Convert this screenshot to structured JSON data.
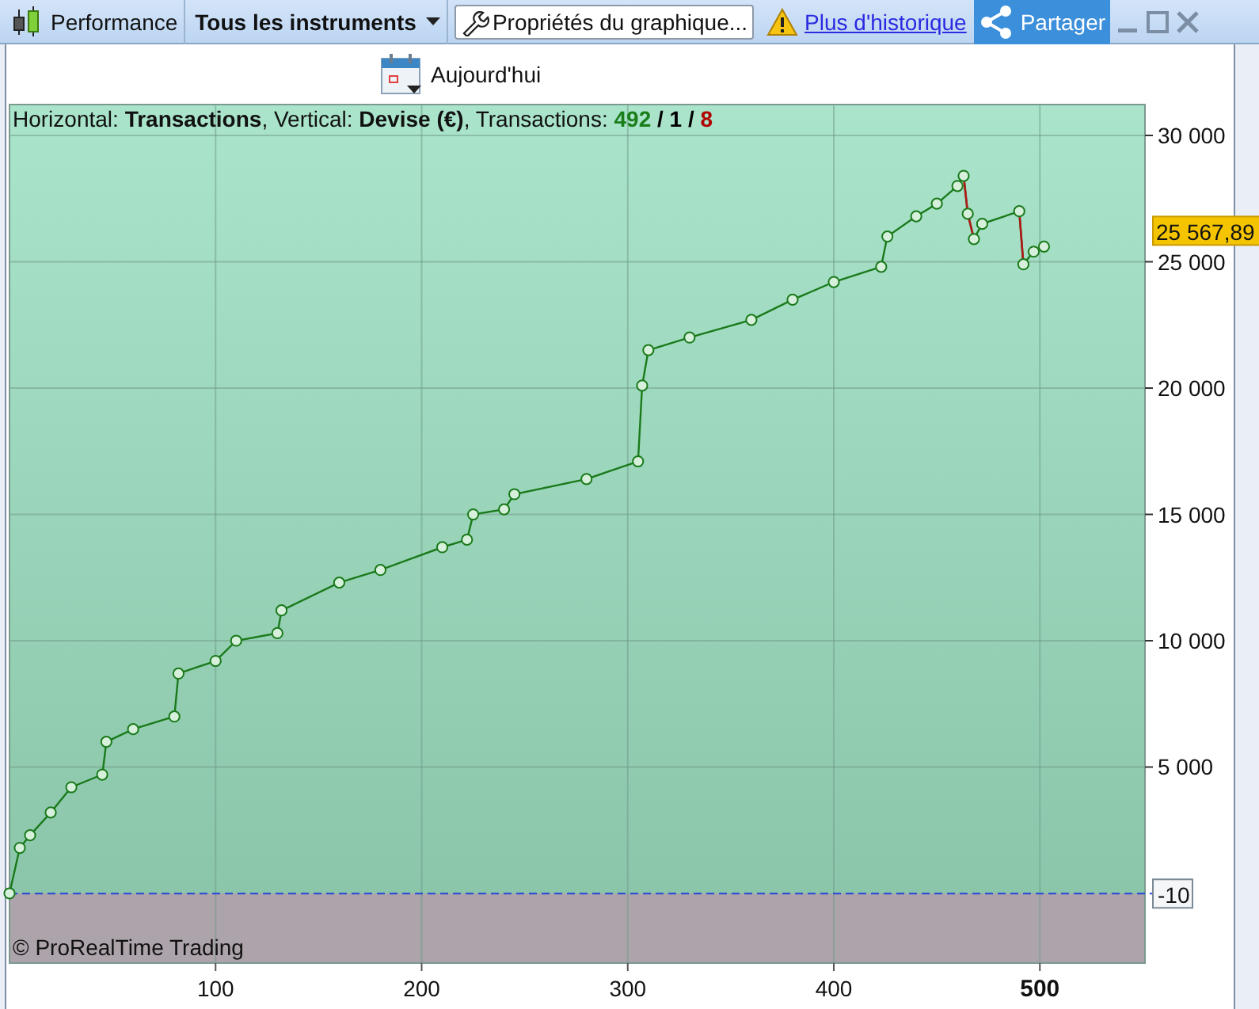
{
  "toolbar": {
    "performance_tab": "Performance",
    "instruments_menu": "Tous les instruments",
    "properties_button": "Propriétés du graphique...",
    "history_link": "Plus d'historique",
    "share_button": "Partager"
  },
  "date_selector": {
    "label": "Aujourd'hui"
  },
  "chart": {
    "info": "Horizontal: **Transactions**, Vertical: **Devise (€)**, Transactions:",
    "info_counts": [
      {
        "text": "492",
        "color": "#1a7f1a"
      },
      {
        "text": "/",
        "color": "#000000"
      },
      {
        "text": "1",
        "color": "#000000"
      },
      {
        "text": "/",
        "color": "#000000"
      },
      {
        "text": "8",
        "color": "#b00000"
      }
    ],
    "copyright": "© ProRealTime Trading",
    "last_value_label": "25 567,89",
    "chart_data": {
      "type": "line",
      "grid": true,
      "xlim": [
        0,
        551
      ],
      "ylim": [
        -2759,
        31223
      ],
      "ref_lines": [
        {
          "axis": "y",
          "value": -10,
          "label": "-10"
        }
      ],
      "xticks": [
        100,
        200,
        300,
        400,
        500
      ],
      "yticks": [
        {
          "value": 5000,
          "label": "5 000"
        },
        {
          "value": 10000,
          "label": "10 000"
        },
        {
          "value": 15000,
          "label": "15 000"
        },
        {
          "value": 20000,
          "label": "20 000"
        },
        {
          "value": 25000,
          "label": "25 000"
        },
        {
          "value": 30000,
          "label": "30 000"
        }
      ],
      "x": [
        0,
        5,
        10,
        20,
        30,
        45,
        47,
        60,
        80,
        82,
        100,
        110,
        130,
        132,
        160,
        180,
        210,
        222,
        225,
        240,
        245,
        280,
        305,
        307,
        310,
        330,
        360,
        380,
        400,
        423,
        426,
        440,
        450,
        460,
        463,
        465,
        468,
        472,
        490,
        492,
        497,
        502
      ],
      "series": [
        {
          "color": "#1a7a1a",
          "marker": true,
          "values": [
            0,
            1800,
            2300,
            3200,
            4200,
            4700,
            6000,
            6500,
            7000,
            8700,
            9200,
            10000,
            10300,
            11200,
            12300,
            12800,
            13700,
            14000,
            15000,
            15200,
            15800,
            16400,
            17100,
            20100,
            21500,
            22000,
            22700,
            23500,
            24200,
            24800,
            26000,
            26800,
            27300,
            28000,
            28400,
            26900,
            25900,
            26500,
            27000,
            24900,
            25400,
            25600
          ]
        }
      ]
    }
  }
}
